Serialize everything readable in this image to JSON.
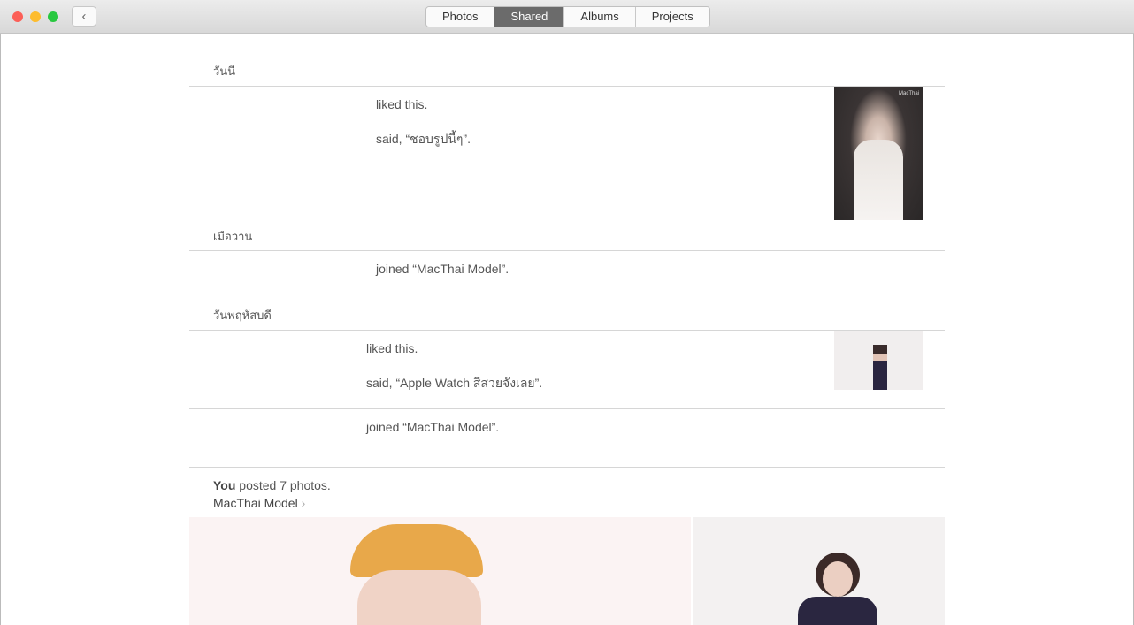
{
  "toolbar": {
    "back_icon": "chevron-left-icon",
    "tabs": [
      {
        "label": "Photos"
      },
      {
        "label": "Shared",
        "active": true
      },
      {
        "label": "Albums"
      },
      {
        "label": "Projects"
      }
    ]
  },
  "colors": {
    "close": "#fc5f57",
    "minimize": "#fdbc2e",
    "zoom": "#28c840",
    "active_tab": "#6b6b6b"
  },
  "feed": {
    "sections": [
      {
        "header": "วันนี",
        "items": [
          {
            "text": "liked this."
          },
          {
            "text": "said, “ชอบรูปนี้ๆ”."
          }
        ]
      },
      {
        "header": "เมือวาน",
        "items": [
          {
            "text": "joined “MacThai Model”."
          }
        ]
      },
      {
        "header": "วันพฤหัสบดี",
        "items": [
          {
            "text": "liked this."
          },
          {
            "text": "said, “Apple Watch สีสวยจังเลย”."
          },
          {
            "text": "joined “MacThai Model”."
          }
        ]
      }
    ],
    "post": {
      "user": "You",
      "text": " posted 7 photos.",
      "album": "MacThai Model",
      "chevron_icon": "chevron-right-icon"
    },
    "thumb_logo": "MacThai"
  }
}
